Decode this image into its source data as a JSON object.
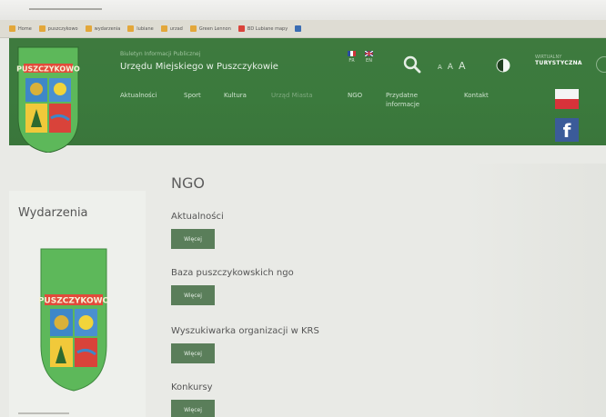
{
  "bookmarks": [
    "Home",
    "puszczykowo",
    "wydarzenia",
    "lubiane",
    "urzad",
    "Green Lennon",
    "BD Lubiane mapy"
  ],
  "header": {
    "logo_text": "PUSZCZYKOWO",
    "office_subtitle": "Biuletyn Informacji Publicznej",
    "office_title": "Urzędu Miejskiego w Puszczykowie",
    "languages": [
      {
        "code": "FR",
        "colors": [
          "#2b4ea0",
          "#ffffff",
          "#d1323a"
        ]
      },
      {
        "code": "EN",
        "colors": [
          "#24386e",
          "#ffffff",
          "#c8333a"
        ]
      }
    ],
    "font_sizes": [
      "A",
      "A",
      "A"
    ],
    "tourism_small": "WIRTUALNY",
    "tourism_big": "TURYSTYCZNA",
    "nav": [
      "Aktualności",
      "Sport",
      "Kultura",
      "Urząd Miasta",
      "NGO",
      "Przydatne informacje",
      "Kontakt"
    ],
    "facebook": "f"
  },
  "sidebar": {
    "title": "Wydarzenia",
    "logo_text": "PUSZCZYKOWO"
  },
  "main": {
    "title": "NGO",
    "entries": [
      {
        "title": "Aktualności",
        "button": "Więcej"
      },
      {
        "title": "Baza puszczykowskich ngo",
        "button": "Więcej"
      },
      {
        "title": "Wyszukiwarka organizacji w KRS",
        "button": "Więcej"
      },
      {
        "title": "Konkursy",
        "button": "Więcej"
      }
    ]
  },
  "colors": {
    "header_green": "#3b7a3d",
    "button_green": "#5a7e5a",
    "crest_green": "#5db85a",
    "crest_red": "#d9433a",
    "crest_blue": "#3e87c8",
    "crest_yellow": "#f1c93a",
    "facebook_blue": "#3b5b99"
  },
  "icons": [
    "search-icon",
    "contrast-icon",
    "facebook-icon",
    "poland-flag-icon",
    "chevron-right-icon"
  ]
}
